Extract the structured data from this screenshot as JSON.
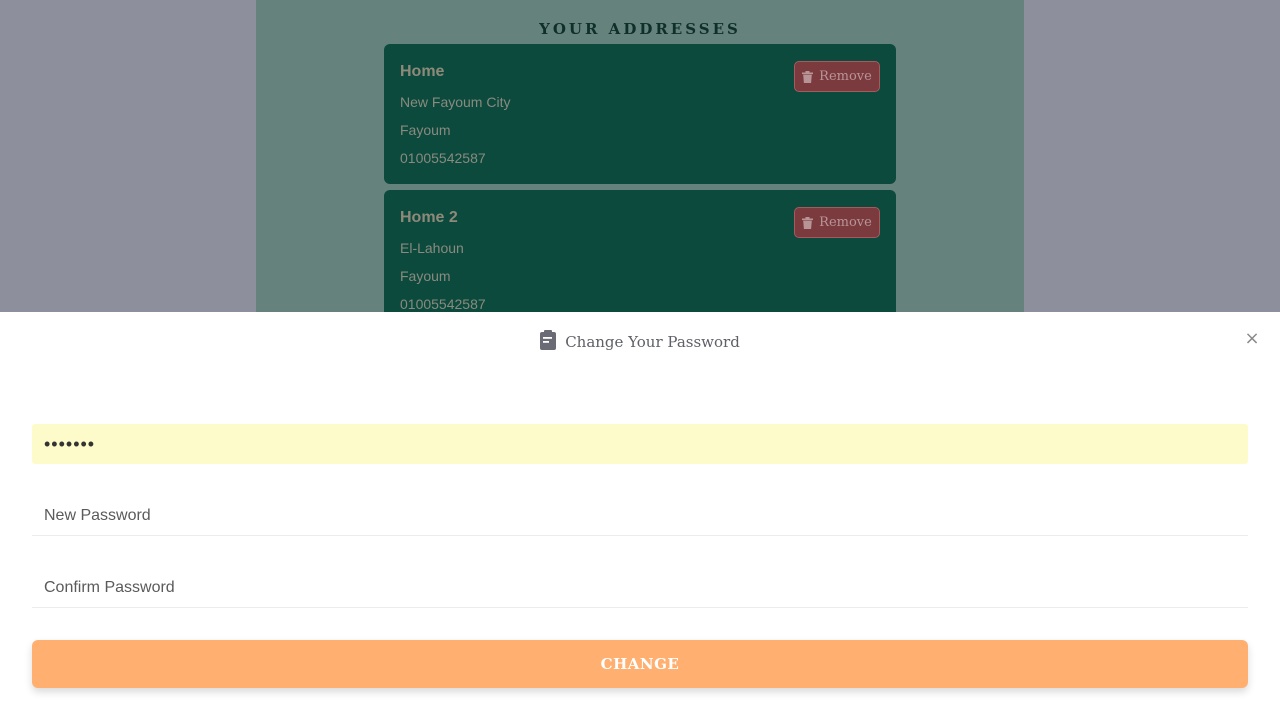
{
  "addresses": {
    "title": "YOUR ADDRESSES",
    "items": [
      {
        "name": "Home",
        "line1": "New Fayoum City",
        "line2": "Fayoum",
        "phone": "01005542587",
        "remove_label": "Remove"
      },
      {
        "name": "Home 2",
        "line1": "El-Lahoun",
        "line2": "Fayoum",
        "phone": "01005542587",
        "remove_label": "Remove"
      }
    ]
  },
  "modal": {
    "title": "Change Your Password",
    "title_icon": "clipboard-icon",
    "close_icon": "close-icon",
    "current_password_value": "•••••••",
    "new_password_placeholder": "New Password",
    "confirm_password_placeholder": "Confirm Password",
    "submit_label": "CHANGE"
  },
  "colors": {
    "overlay": "#8e8f9c",
    "panel": "#66827c",
    "card": "#0b4a3d",
    "remove": "#7a3a3e",
    "autofill": "#fefbcb",
    "accent": "#ffb071"
  }
}
